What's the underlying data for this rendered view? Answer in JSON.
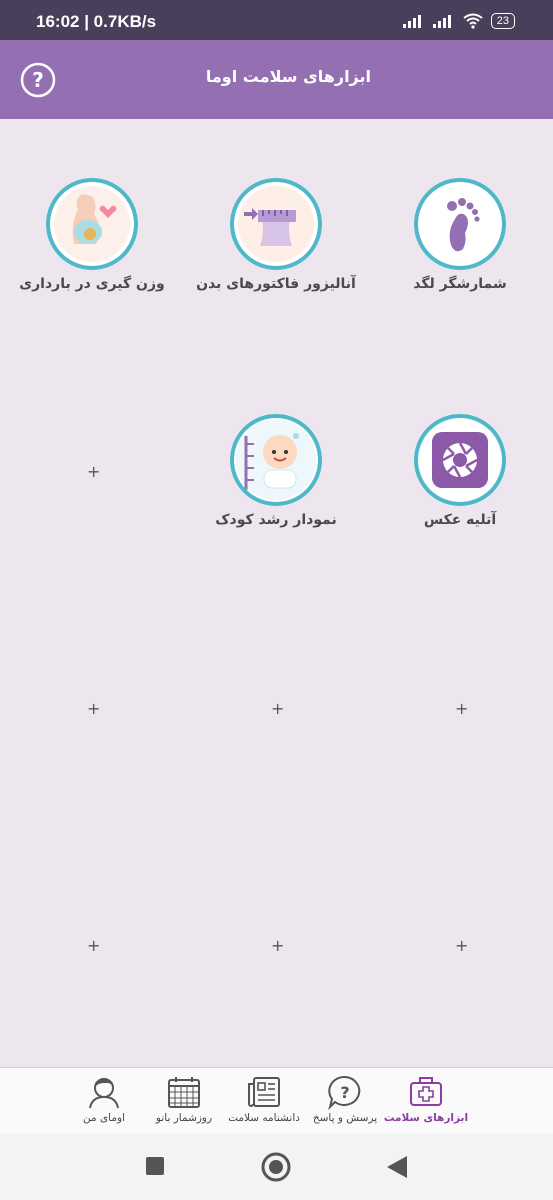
{
  "status": {
    "time": "16:02 | 0.7KB/s",
    "battery": "23"
  },
  "app_bar": {
    "title": "ابزارهای سلامت اوما",
    "help_icon": "question-circle-icon"
  },
  "tools": [
    {
      "label": "شمارشگر لگد",
      "icon": "baby-foot-icon"
    },
    {
      "label": "آنالیزور فاکتورهای بدن",
      "icon": "body-measure-icon"
    },
    {
      "label": "وزن گیری در بارداری",
      "icon": "pregnant-scale-icon"
    },
    {
      "label": "آتلیه عکس",
      "icon": "camera-aperture-icon"
    },
    {
      "label": "نمودار رشد کودک",
      "icon": "baby-growth-icon"
    }
  ],
  "add_slot": "+",
  "bottom_nav": [
    {
      "label": "ابزارهای سلامت",
      "icon": "medical-kit-icon",
      "active": true
    },
    {
      "label": "پرسش و پاسخ",
      "icon": "question-bubble-icon",
      "active": false
    },
    {
      "label": "دانشنامه سلامت",
      "icon": "newspaper-icon",
      "active": false
    },
    {
      "label": "روزشمار بانو",
      "icon": "calendar-icon",
      "active": false
    },
    {
      "label": "اومای من",
      "icon": "user-avatar-icon",
      "active": false
    }
  ],
  "colors": {
    "primary": "#9470b3",
    "accent": "#4fb8c8",
    "background": "#ede6ef",
    "active_nav": "#8a3ea0"
  }
}
